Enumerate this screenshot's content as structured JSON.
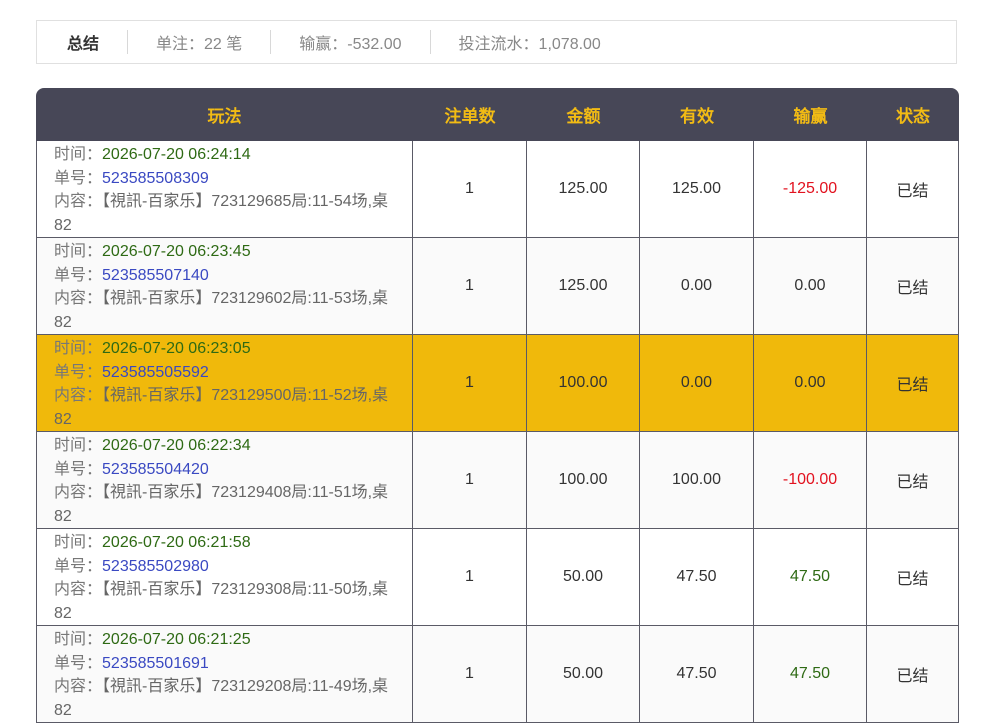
{
  "summary": {
    "title": "总结",
    "bets": "单注：22 笔",
    "winloss": "输赢：-532.00",
    "turnover": "投注流水：1,078.00"
  },
  "table": {
    "headers": [
      "玩法",
      "注单数",
      "金额",
      "有效",
      "输赢",
      "状态"
    ],
    "time_label": "时间：",
    "order_label": "单号：",
    "content_label": "内容：",
    "rows": [
      {
        "time": "2026-07-20 06:24:14",
        "order": "523585508309",
        "content": "【視訊-百家乐】723129685局:11-54场,桌82",
        "count": "1",
        "amount": "125.00",
        "valid": "125.00",
        "winloss": "-125.00",
        "status": "已结"
      },
      {
        "time": "2026-07-20 06:23:45",
        "order": "523585507140",
        "content": "【視訊-百家乐】723129602局:11-53场,桌82",
        "count": "1",
        "amount": "125.00",
        "valid": "0.00",
        "winloss": "0.00",
        "status": "已结"
      },
      {
        "time": "2026-07-20 06:23:05",
        "order": "523585505592",
        "content": "【視訊-百家乐】723129500局:11-52场,桌82",
        "count": "1",
        "amount": "100.00",
        "valid": "0.00",
        "winloss": "0.00",
        "status": "已结"
      },
      {
        "time": "2026-07-20 06:22:34",
        "order": "523585504420",
        "content": "【視訊-百家乐】723129408局:11-51场,桌82",
        "count": "1",
        "amount": "100.00",
        "valid": "100.00",
        "winloss": "-100.00",
        "status": "已结"
      },
      {
        "time": "2026-07-20 06:21:58",
        "order": "523585502980",
        "content": "【視訊-百家乐】723129308局:11-50场,桌82",
        "count": "1",
        "amount": "50.00",
        "valid": "47.50",
        "winloss": "47.50",
        "status": "已结"
      },
      {
        "time": "2026-07-20 06:21:25",
        "order": "523585501691",
        "content": "【視訊-百家乐】723129208局:11-49场,桌82",
        "count": "1",
        "amount": "50.00",
        "valid": "47.50",
        "winloss": "47.50",
        "status": "已结"
      }
    ]
  },
  "colors": {
    "header_bg": "#474757",
    "header_text": "#f2bb14",
    "highlight_row": "#f0b90b",
    "negative": "#e2121f",
    "positive": "#2e6a14",
    "order_link": "#3a49c2"
  }
}
